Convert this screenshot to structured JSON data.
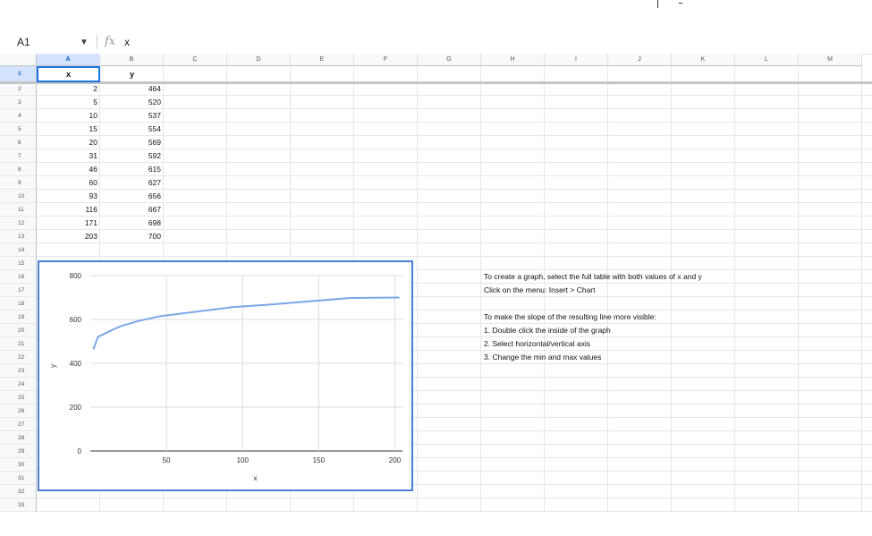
{
  "formula_bar": {
    "name_box": "A1",
    "formula": "x"
  },
  "columns": [
    "A",
    "B",
    "C",
    "D",
    "E",
    "F",
    "G",
    "H",
    "I",
    "J",
    "K",
    "L",
    "M"
  ],
  "rows": [
    "1",
    "2",
    "3",
    "4",
    "5",
    "6",
    "7",
    "8",
    "9",
    "10",
    "11",
    "12",
    "13",
    "14",
    "15",
    "16",
    "17",
    "18",
    "19",
    "20",
    "21",
    "22",
    "23",
    "24",
    "25",
    "26",
    "27",
    "28",
    "29",
    "30",
    "31",
    "32",
    "33"
  ],
  "table": {
    "headers": [
      "x",
      "y"
    ],
    "rows": [
      [
        "2",
        "464"
      ],
      [
        "5",
        "520"
      ],
      [
        "10",
        "537"
      ],
      [
        "15",
        "554"
      ],
      [
        "20",
        "569"
      ],
      [
        "31",
        "592"
      ],
      [
        "46",
        "615"
      ],
      [
        "60",
        "627"
      ],
      [
        "93",
        "656"
      ],
      [
        "116",
        "667"
      ],
      [
        "171",
        "698"
      ],
      [
        "203",
        "700"
      ]
    ]
  },
  "notes": [
    "To create a graph, select the full table with both values of x and y",
    "Click on the menu: Insert > Chart",
    "",
    "To make the slope of the resulting line more visible:",
    "1. Double click the inside of the graph",
    "2. Select horizontal/vertical axis",
    "3. Change the min and max values"
  ],
  "chart_data": {
    "type": "line",
    "x": [
      2,
      5,
      10,
      15,
      20,
      31,
      46,
      60,
      93,
      116,
      171,
      203
    ],
    "series": [
      {
        "values": [
          464,
          520,
          537,
          554,
          569,
          592,
          615,
          627,
          656,
          667,
          698,
          700
        ]
      }
    ],
    "xlabel": "x",
    "ylabel": "y",
    "xticks": [
      50,
      100,
      150,
      200
    ],
    "yticks": [
      0,
      200,
      400,
      600,
      800
    ],
    "xlim": [
      0,
      205
    ],
    "ylim": [
      0,
      800
    ],
    "grid": true,
    "line_color": "#7aa7e8"
  },
  "colors": {
    "selection": "#1a73e8",
    "chart_border": "#4a7fd1",
    "header_bg": "#f8f9fa",
    "selected_header_bg": "#d3e3fd"
  }
}
